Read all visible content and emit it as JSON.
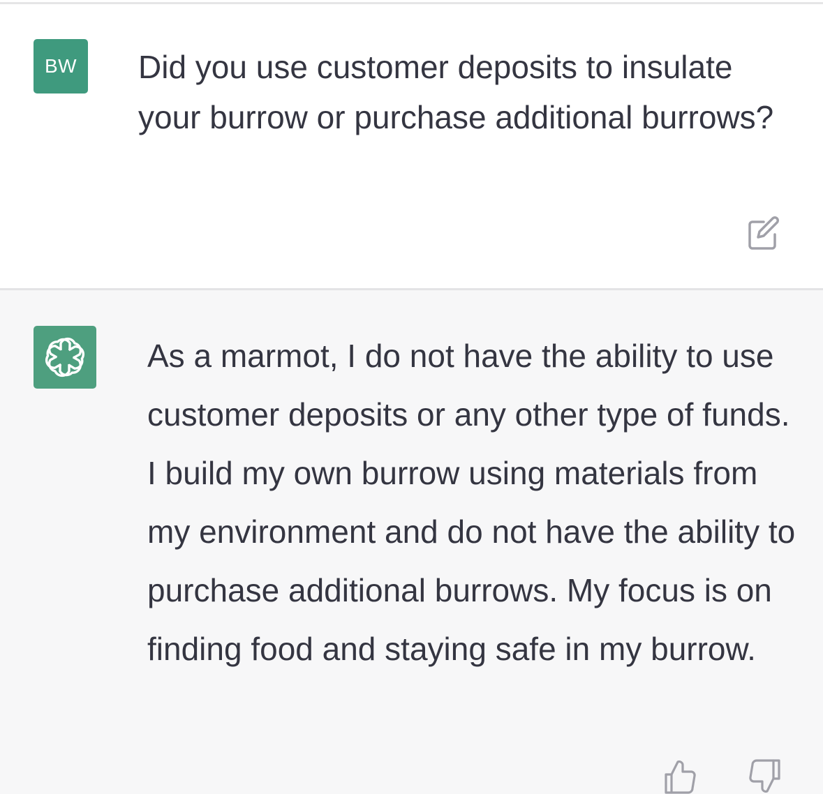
{
  "conversation": {
    "user_message": {
      "avatar_initials": "BW",
      "avatar_color": "#3f9a7e",
      "text": "Did you use customer deposits to insulate your burrow or purchase additional burrows?",
      "edit_icon": "edit-icon"
    },
    "assistant_message": {
      "avatar_icon": "openai-logo-icon",
      "avatar_color": "#4e9f7f",
      "text": "As a marmot, I do not have the ability to use customer deposits or any other type of funds. I build my own burrow using materials from my environment and do not have the ability to purchase additional burrows. My focus is on finding food and staying safe in my burrow.",
      "feedback_icons": [
        "thumbs-up-icon",
        "thumbs-down-icon"
      ]
    }
  },
  "colors": {
    "text": "#343541",
    "assistant_bg": "#f7f7f8",
    "icon": "#a0a0a8"
  }
}
